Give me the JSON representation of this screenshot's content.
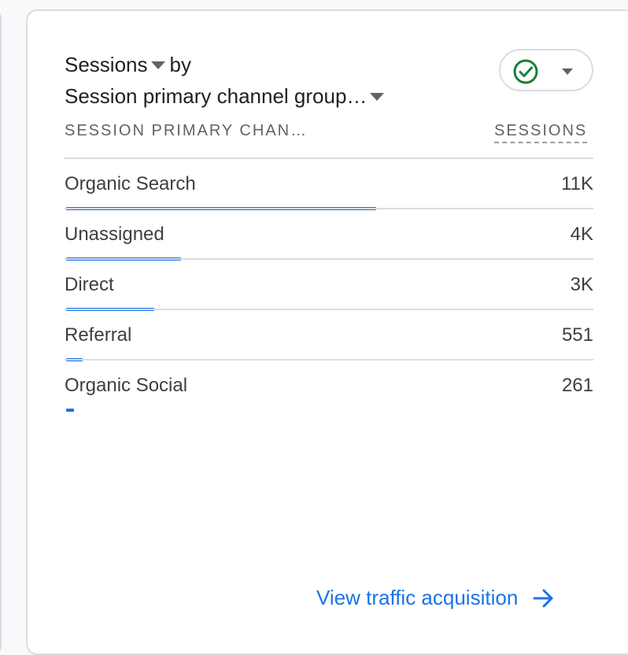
{
  "card": {
    "title": {
      "metric": "Sessions",
      "by": "by",
      "dimension": "Session primary channel group…"
    },
    "compare_icon": "check-circle-icon",
    "columns": {
      "dimension": "SESSION PRIMARY CHAN…",
      "metric": "SESSIONS"
    },
    "rows": [
      {
        "label": "Organic Search",
        "value": "11K",
        "share": 0.587
      },
      {
        "label": "Unassigned",
        "value": "4K",
        "share": 0.217
      },
      {
        "label": "Direct",
        "value": "3K",
        "share": 0.166
      },
      {
        "label": "Referral",
        "value": "551",
        "share": 0.031
      },
      {
        "label": "Organic Social",
        "value": "261",
        "share": 0.015
      }
    ],
    "footer_link": "View traffic acquisition",
    "footer_icon": "arrow-right-icon"
  },
  "colors": {
    "accent": "#1a73e8",
    "check": "#188038",
    "text": "#202124",
    "muted": "#5f6368",
    "divider": "#dadce0"
  }
}
